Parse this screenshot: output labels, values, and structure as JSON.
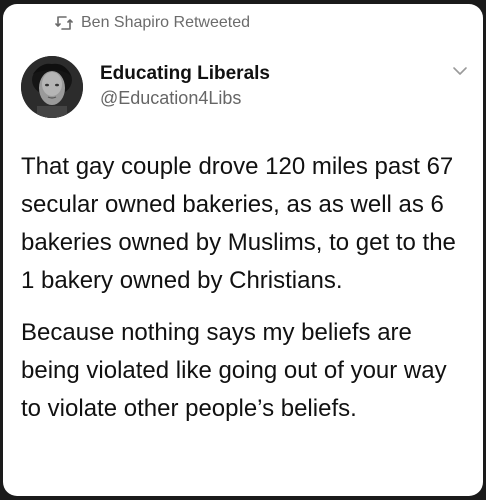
{
  "retweet": {
    "label": "Ben Shapiro Retweeted",
    "icon": "retweet-icon"
  },
  "author": {
    "display_name": "Educating Liberals",
    "handle": "@Education4Libs",
    "avatar_icon": "avatar-photo"
  },
  "menu": {
    "icon": "chevron-down-icon"
  },
  "tweet": {
    "paragraph_1": "That gay couple drove 120 miles past 67 secular owned bakeries, as as well as 6 bakeries owned by Muslims, to get to the 1 bakery owned by Christians.",
    "paragraph_2": "Because nothing says my beliefs are being violated like going out of your way to violate other people’s beliefs."
  },
  "colors": {
    "background": "#1a1a1a",
    "card": "#ffffff",
    "text": "#111111",
    "muted": "#666666"
  }
}
